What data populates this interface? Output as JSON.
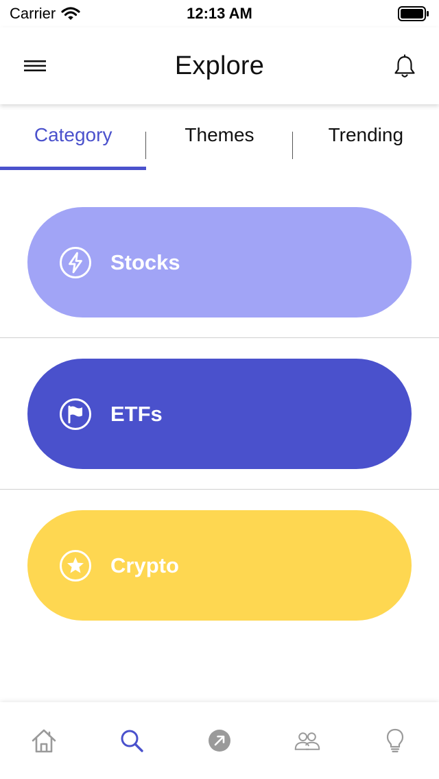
{
  "status_bar": {
    "carrier": "Carrier",
    "time": "12:13 AM"
  },
  "header": {
    "title": "Explore",
    "menu_icon": "hamburger-menu-icon",
    "bell_icon": "bell-icon"
  },
  "tabs": [
    {
      "label": "Category",
      "active": true
    },
    {
      "label": "Themes",
      "active": false
    },
    {
      "label": "Trending",
      "active": false
    }
  ],
  "categories": [
    {
      "label": "Stocks",
      "icon": "lightning-bolt-icon",
      "color": "#a1a4f6"
    },
    {
      "label": "ETFs",
      "icon": "flag-icon",
      "color": "#4a51cc"
    },
    {
      "label": "Crypto",
      "icon": "star-icon",
      "color": "#fed751"
    }
  ],
  "bottom_nav": [
    {
      "name": "home",
      "icon": "home-icon",
      "active": false
    },
    {
      "name": "explore",
      "icon": "search-icon",
      "active": true
    },
    {
      "name": "trade",
      "icon": "arrow-circle-icon",
      "active": false
    },
    {
      "name": "community",
      "icon": "people-icon",
      "active": false
    },
    {
      "name": "ideas",
      "icon": "lightbulb-icon",
      "active": false
    }
  ],
  "colors": {
    "accent": "#4a51cc",
    "inactive_icon": "#9a9a9a"
  }
}
